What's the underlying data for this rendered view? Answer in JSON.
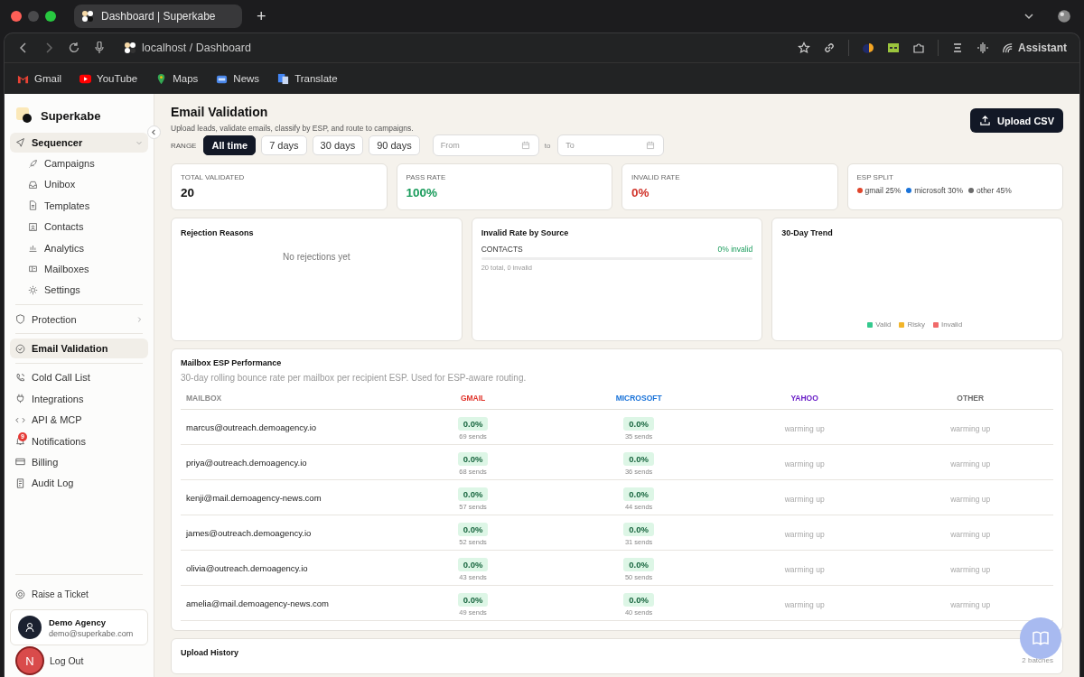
{
  "browser": {
    "tab_title": "Dashboard | Superkabe",
    "new_tab": "+",
    "url": "localhost / Dashboard",
    "assistant": "Assistant",
    "bookmarks": [
      "Gmail",
      "YouTube",
      "Maps",
      "News",
      "Translate"
    ]
  },
  "sidebar": {
    "brand": "Superkabe",
    "sections": [
      [
        {
          "label": "Sequencer",
          "selected": true,
          "expanded": true,
          "children": [
            {
              "label": "Campaigns",
              "selected": false
            },
            {
              "label": "Unibox",
              "selected": false
            },
            {
              "label": "Templates",
              "selected": false
            },
            {
              "label": "Contacts",
              "selected": false
            },
            {
              "label": "Analytics",
              "selected": false
            },
            {
              "label": "Mailboxes",
              "selected": false
            },
            {
              "label": "Settings",
              "selected": false
            }
          ]
        }
      ],
      [
        {
          "label": "Protection",
          "selected": false,
          "expanded": false
        }
      ],
      [
        {
          "label": "Email Validation",
          "selected": true
        }
      ],
      [
        {
          "label": "Cold Call List",
          "selected": false
        },
        {
          "label": "Integrations",
          "selected": false
        },
        {
          "label": "API & MCP",
          "selected": false
        },
        {
          "label": "Notifications",
          "selected": false,
          "badge": "9"
        },
        {
          "label": "Billing",
          "selected": false
        },
        {
          "label": "Audit Log",
          "selected": false
        }
      ]
    ],
    "support": "Raise a Ticket",
    "account": {
      "name": "Demo Agency",
      "email": "demo@superkabe.com"
    },
    "logout": "Log Out",
    "dev_badge": "N"
  },
  "header": {
    "title": "Email Validation",
    "subtitle": "Upload leads, validate emails, classify by ESP, and route to campaigns.",
    "upload_button": "Upload CSV"
  },
  "range": {
    "label": "RANGE",
    "options": [
      {
        "label": "All time",
        "selected": true
      },
      {
        "label": "7 days",
        "selected": false
      },
      {
        "label": "30 days",
        "selected": false
      },
      {
        "label": "90 days",
        "selected": false
      }
    ],
    "from": {
      "placeholder": "From"
    },
    "separator": "to",
    "to": {
      "placeholder": "To"
    }
  },
  "stats": [
    {
      "label": "TOTAL VALIDATED",
      "value": "20",
      "kind": "neutral"
    },
    {
      "label": "PASS RATE",
      "value": "100%",
      "kind": "good"
    },
    {
      "label": "INVALID RATE",
      "value": "0%",
      "kind": "bad"
    },
    {
      "label": "ESP SPLIT",
      "kind": "split",
      "segments": [
        {
          "label": "gmail 25%",
          "color": "#e0452b"
        },
        {
          "label": "microsoft 30%",
          "color": "#1a73d9"
        },
        {
          "label": "other 45%",
          "color": "#6b6b6b"
        }
      ]
    }
  ],
  "rejections": {
    "title": "Rejection Reasons",
    "empty": "No rejections yet"
  },
  "sources": {
    "title": "Invalid Rate by Source",
    "rows": [
      {
        "name": "CONTACTS",
        "rate": "0% invalid",
        "level": 0,
        "detail": "20 total, 0 invalid"
      }
    ]
  },
  "trend": {
    "title": "30-Day Trend",
    "legend": [
      {
        "label": "Valid",
        "color": "#34c98e"
      },
      {
        "label": "Risky",
        "color": "#f2b52a"
      },
      {
        "label": "Invalid",
        "color": "#f06a6a"
      }
    ]
  },
  "esp": {
    "title": "Mailbox ESP Performance",
    "subtitle": "30-day rolling bounce rate per mailbox per recipient ESP. Used for ESP-aware routing.",
    "columns": [
      {
        "label": "MAILBOX",
        "color": "#8a8a8a"
      },
      {
        "label": "GMAIL",
        "color": "#e0342b"
      },
      {
        "label": "MICROSOFT",
        "color": "#1a73d9"
      },
      {
        "label": "YAHOO",
        "color": "#6a1fc7"
      },
      {
        "label": "OTHER",
        "color": "#6b6b6b"
      }
    ],
    "rows": [
      {
        "cells": [
          {
            "kind": "mailbox",
            "text": "marcus@outreach.demoagency.io"
          },
          {
            "kind": "rate",
            "value": "0.0%",
            "sends": "69 sends"
          },
          {
            "kind": "rate",
            "value": "0.0%",
            "sends": "35 sends"
          },
          {
            "kind": "warming",
            "text": "warming up"
          },
          {
            "kind": "warming",
            "text": "warming up"
          }
        ]
      },
      {
        "cells": [
          {
            "kind": "mailbox",
            "text": "priya@outreach.demoagency.io"
          },
          {
            "kind": "rate",
            "value": "0.0%",
            "sends": "68 sends"
          },
          {
            "kind": "rate",
            "value": "0.0%",
            "sends": "36 sends"
          },
          {
            "kind": "warming",
            "text": "warming up"
          },
          {
            "kind": "warming",
            "text": "warming up"
          }
        ]
      },
      {
        "cells": [
          {
            "kind": "mailbox",
            "text": "kenji@mail.demoagency-news.com"
          },
          {
            "kind": "rate",
            "value": "0.0%",
            "sends": "57 sends"
          },
          {
            "kind": "rate",
            "value": "0.0%",
            "sends": "44 sends"
          },
          {
            "kind": "warming",
            "text": "warming up"
          },
          {
            "kind": "warming",
            "text": "warming up"
          }
        ]
      },
      {
        "cells": [
          {
            "kind": "mailbox",
            "text": "james@outreach.demoagency.io"
          },
          {
            "kind": "rate",
            "value": "0.0%",
            "sends": "52 sends"
          },
          {
            "kind": "rate",
            "value": "0.0%",
            "sends": "31 sends"
          },
          {
            "kind": "warming",
            "text": "warming up"
          },
          {
            "kind": "warming",
            "text": "warming up"
          }
        ]
      },
      {
        "cells": [
          {
            "kind": "mailbox",
            "text": "olivia@outreach.demoagency.io"
          },
          {
            "kind": "rate",
            "value": "0.0%",
            "sends": "43 sends"
          },
          {
            "kind": "rate",
            "value": "0.0%",
            "sends": "50 sends"
          },
          {
            "kind": "warming",
            "text": "warming up"
          },
          {
            "kind": "warming",
            "text": "warming up"
          }
        ]
      },
      {
        "cells": [
          {
            "kind": "mailbox",
            "text": "amelia@mail.demoagency-news.com"
          },
          {
            "kind": "rate",
            "value": "0.0%",
            "sends": "49 sends"
          },
          {
            "kind": "rate",
            "value": "0.0%",
            "sends": "40 sends"
          },
          {
            "kind": "warming",
            "text": "warming up"
          },
          {
            "kind": "warming",
            "text": "warming up"
          }
        ]
      }
    ]
  },
  "uploads": {
    "title": "Upload History",
    "count": "2 batches"
  }
}
